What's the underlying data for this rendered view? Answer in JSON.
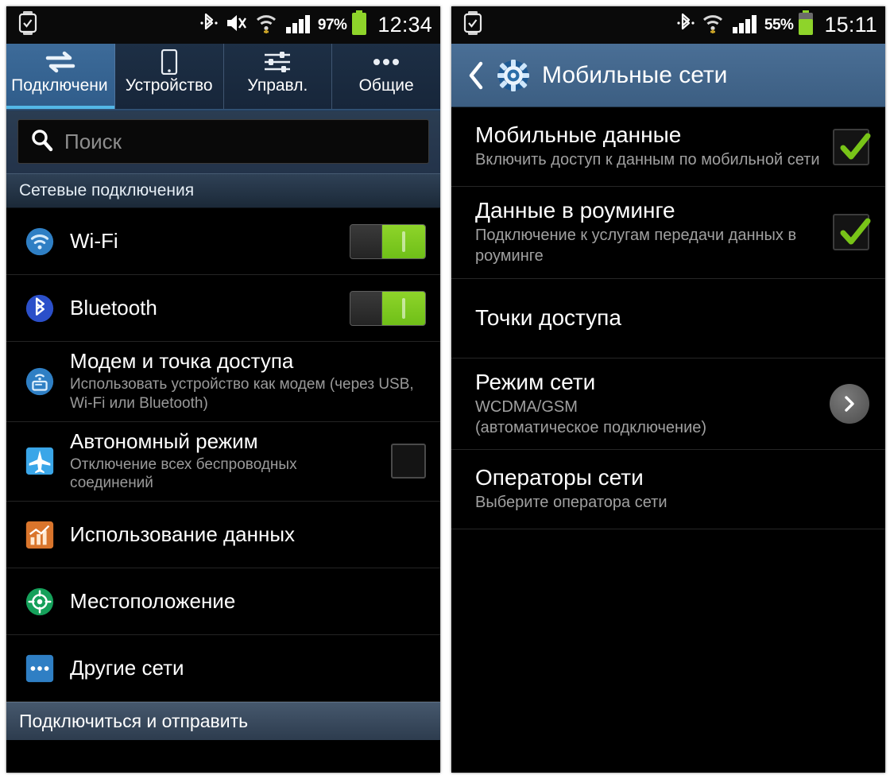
{
  "left_panel": {
    "statusbar": {
      "icons": [
        "watch-icon",
        "bluetooth-icon",
        "mute-icon",
        "wifi-icon",
        "signal-icon"
      ],
      "battery_percent": "97%",
      "clock": "12:34"
    },
    "tabs": [
      {
        "label": "Подключени",
        "icon": "connections-arrows-icon",
        "active": true
      },
      {
        "label": "Устройство",
        "icon": "phone-icon",
        "active": false
      },
      {
        "label": "Управл.",
        "icon": "sliders-icon",
        "active": false
      },
      {
        "label": "Общие",
        "icon": "more-dots-icon",
        "active": false
      }
    ],
    "search": {
      "placeholder": "Поиск",
      "icon": "search-icon"
    },
    "section_header": "Сетевые подключения",
    "rows": [
      {
        "icon": "wifi-circle-icon",
        "title": "Wi-Fi",
        "subtitle": "",
        "control": "toggle-on"
      },
      {
        "icon": "bluetooth-circle-icon",
        "title": "Bluetooth",
        "subtitle": "",
        "control": "toggle-on"
      },
      {
        "icon": "tethering-icon",
        "title": "Модем и точка доступа",
        "subtitle": "Использовать устройство как модем (через USB, Wi-Fi или Bluetooth)",
        "control": "none"
      },
      {
        "icon": "airplane-icon",
        "title": "Автономный режим",
        "subtitle": "Отключение всех беспроводных соединений",
        "control": "checkbox-off"
      },
      {
        "icon": "data-usage-icon",
        "title": "Использование данных",
        "subtitle": "",
        "control": "none"
      },
      {
        "icon": "location-icon",
        "title": "Местоположение",
        "subtitle": "",
        "control": "none"
      },
      {
        "icon": "other-networks-icon",
        "title": "Другие сети",
        "subtitle": "",
        "control": "none"
      }
    ],
    "bottom_bar": "Подключиться и отправить"
  },
  "right_panel": {
    "statusbar": {
      "icons": [
        "watch-icon",
        "bluetooth-icon",
        "wifi-icon",
        "signal-icon"
      ],
      "battery_percent": "55%",
      "clock": "15:11"
    },
    "actionbar": {
      "back_icon": "back-chevron-icon",
      "gear_icon": "settings-gear-icon",
      "title": "Мобильные сети"
    },
    "rows": [
      {
        "title": "Мобильные данные",
        "subtitle": "Включить доступ к данным по мобильной сети",
        "control": "checkbox-on"
      },
      {
        "title": "Данные в роуминге",
        "subtitle": "Подключение к услугам передачи данных в роуминге",
        "control": "checkbox-on"
      },
      {
        "title": "Точки доступа",
        "subtitle": "",
        "control": "none"
      },
      {
        "title": "Режим сети",
        "subtitle": "WCDMA/GSM\n(автоматическое подключение)",
        "control": "chevron"
      },
      {
        "title": "Операторы сети",
        "subtitle": "Выберите оператора сети",
        "control": "none"
      }
    ]
  },
  "colors": {
    "accent_blue": "#4a6f96",
    "active_tab_blue": "#3d6b99",
    "tab_underline": "#53b8e8",
    "toggle_green": "#8ed42a",
    "check_green": "#78c418",
    "background": "#000000",
    "subtitle_gray": "#a0a0a0"
  }
}
